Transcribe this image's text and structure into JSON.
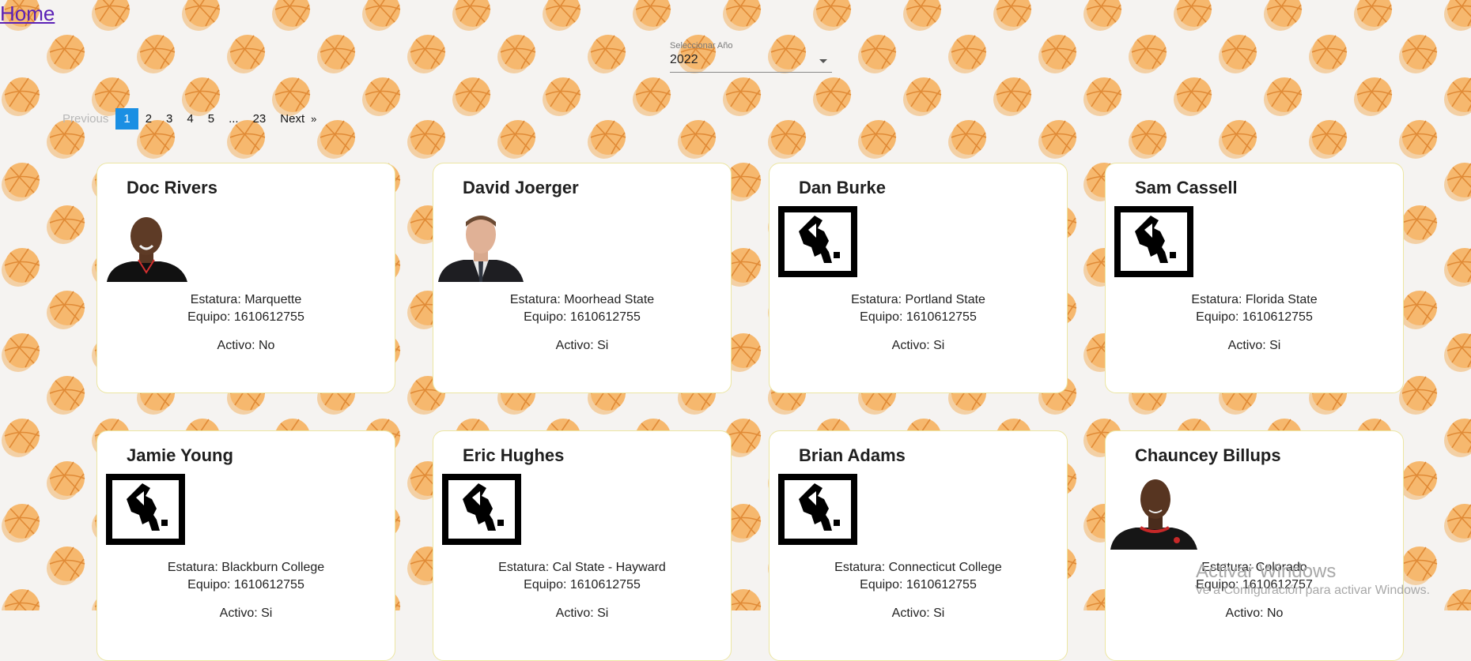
{
  "nav": {
    "home_label": "Home"
  },
  "year_select": {
    "label": "Seleccionar Año",
    "value": "2022"
  },
  "pagination": {
    "previous_label": "Previous",
    "pages": [
      "1",
      "2",
      "3",
      "4",
      "5",
      "...",
      "23"
    ],
    "current": "1",
    "next_label": "Next",
    "next_arrow": "»"
  },
  "players": [
    {
      "name": "Doc Rivers",
      "image": "photo",
      "estatura": "Estatura: Marquette",
      "equipo": "Equipo: 1610612755",
      "activo": "Activo: No"
    },
    {
      "name": "David Joerger",
      "image": "photo",
      "estatura": "Estatura: Moorhead State",
      "equipo": "Equipo: 1610612755",
      "activo": "Activo: Si"
    },
    {
      "name": "Dan Burke",
      "image": "nba-logo-placeholder",
      "estatura": "Estatura: Portland State",
      "equipo": "Equipo: 1610612755",
      "activo": "Activo: Si"
    },
    {
      "name": "Sam Cassell",
      "image": "nba-logo-placeholder",
      "estatura": "Estatura: Florida State",
      "equipo": "Equipo: 1610612755",
      "activo": "Activo: Si"
    },
    {
      "name": "Jamie Young",
      "image": "nba-logo-placeholder",
      "estatura": "Estatura: Blackburn College",
      "equipo": "Equipo: 1610612755",
      "activo": "Activo: Si"
    },
    {
      "name": "Eric Hughes",
      "image": "nba-logo-placeholder",
      "estatura": "Estatura: Cal State - Hayward",
      "equipo": "Equipo: 1610612755",
      "activo": "Activo: Si"
    },
    {
      "name": "Brian Adams",
      "image": "nba-logo-placeholder",
      "estatura": "Estatura: Connecticut College",
      "equipo": "Equipo: 1610612755",
      "activo": "Activo: Si"
    },
    {
      "name": "Chauncey Billups",
      "image": "photo",
      "estatura": "Estatura: Colorado",
      "equipo": "Equipo: 1610612757",
      "activo": "Activo: No"
    }
  ],
  "watermark": {
    "title": "Activar Windows",
    "subtitle": "Ve a Configuración para activar Windows."
  },
  "colors": {
    "background": "#f5f3f1",
    "ball": "#f6b86e",
    "active_page": "#1a8fe3",
    "card_border": "#ece6a2"
  }
}
